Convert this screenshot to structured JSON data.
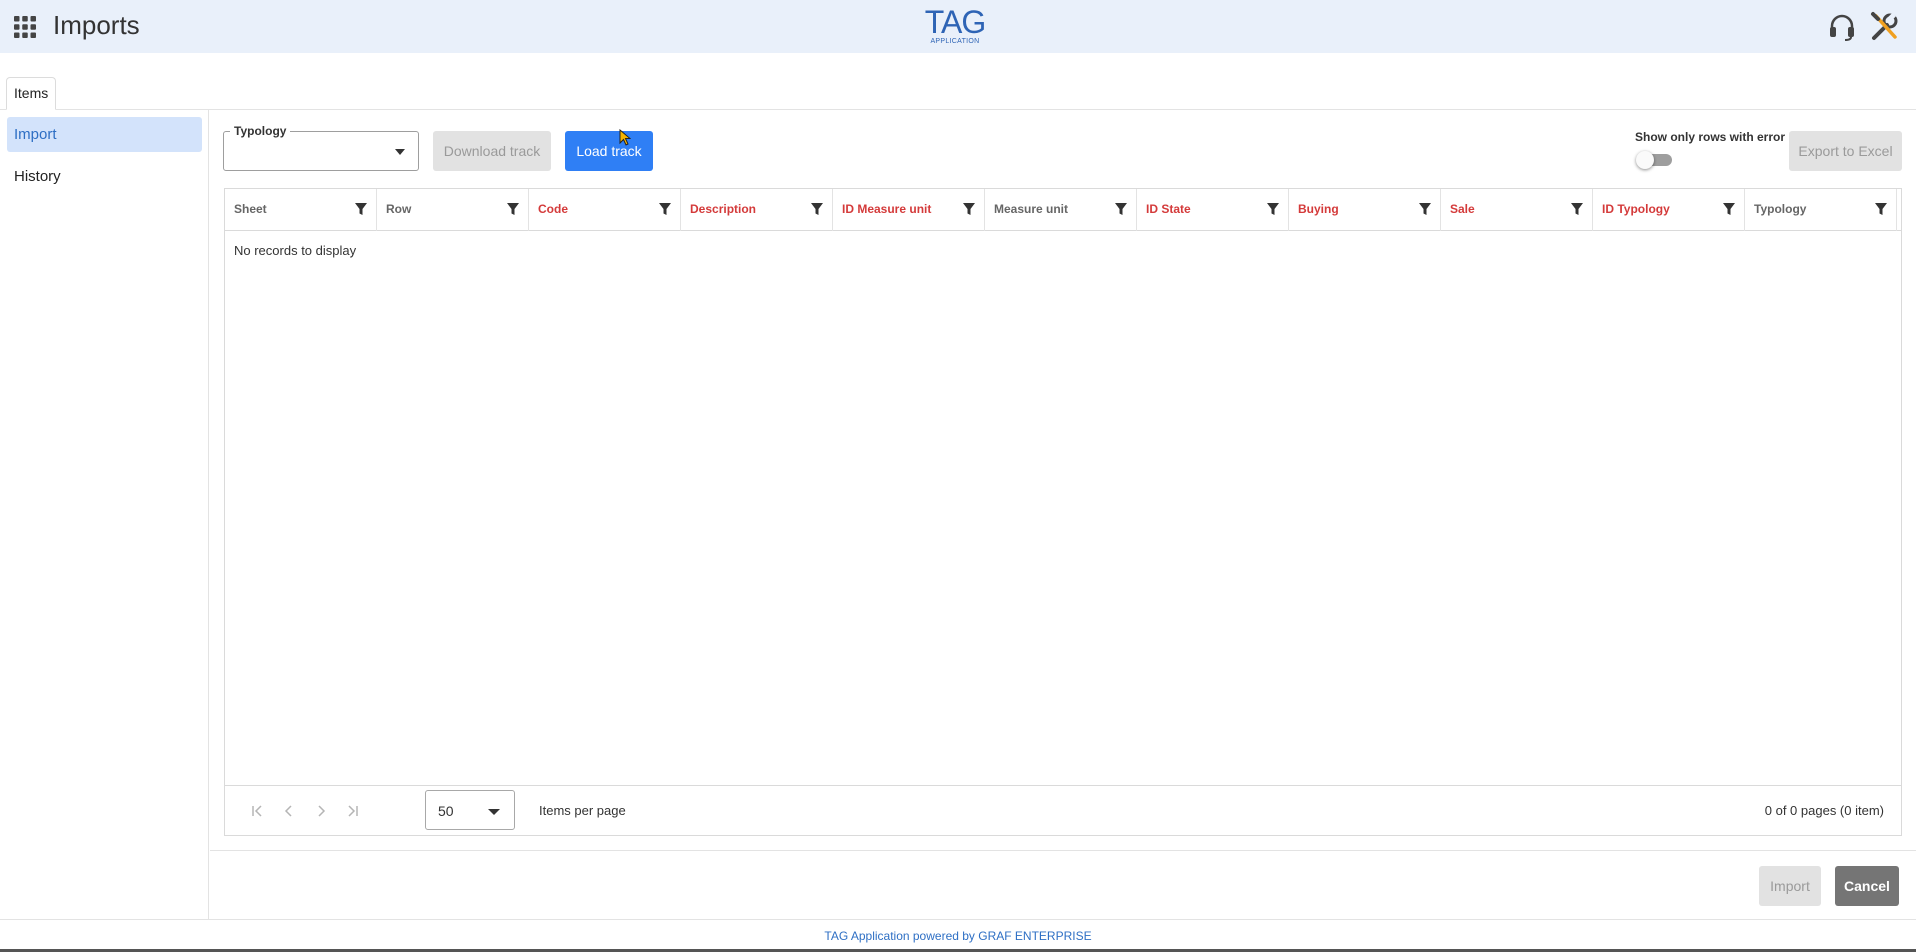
{
  "header": {
    "title": "Imports",
    "logo_main": "TAG",
    "logo_sub": "APPLICATION",
    "icons": [
      "apps-grid-icon",
      "headset-icon",
      "tools-icon"
    ]
  },
  "tabs": [
    {
      "label": "Items",
      "active": true
    }
  ],
  "sidebar": {
    "items": [
      {
        "label": "Import",
        "active": true
      },
      {
        "label": "History",
        "active": false
      }
    ]
  },
  "toolbar": {
    "typology_label": "Typology",
    "typology_value": "",
    "download_label": "Download track",
    "load_label": "Load track",
    "toggle_label": "Show only rows with error",
    "toggle_on": false,
    "export_label": "Export to Excel"
  },
  "grid": {
    "columns": [
      {
        "label": "Sheet",
        "required": false
      },
      {
        "label": "Row",
        "required": false
      },
      {
        "label": "Code",
        "required": true
      },
      {
        "label": "Description",
        "required": true
      },
      {
        "label": "ID Measure unit",
        "required": true
      },
      {
        "label": "Measure unit",
        "required": false
      },
      {
        "label": "ID State",
        "required": true
      },
      {
        "label": "Buying",
        "required": true
      },
      {
        "label": "Sale",
        "required": true
      },
      {
        "label": "ID Typology",
        "required": true
      },
      {
        "label": "Typology",
        "required": false
      }
    ],
    "empty_text": "No records to display",
    "pager": {
      "page_size": "50",
      "per_page_label": "Items per page",
      "info": "0 of 0 pages (0 item)"
    }
  },
  "actions": {
    "import_label": "Import",
    "cancel_label": "Cancel"
  },
  "footer": {
    "text": "TAG Application powered by GRAF ENTERPRISE"
  },
  "colors": {
    "header_bg": "#e9f0fa",
    "accent": "#2f7ff5",
    "required_column": "#d43a3a",
    "active_nav_bg": "#d3e3fb"
  }
}
